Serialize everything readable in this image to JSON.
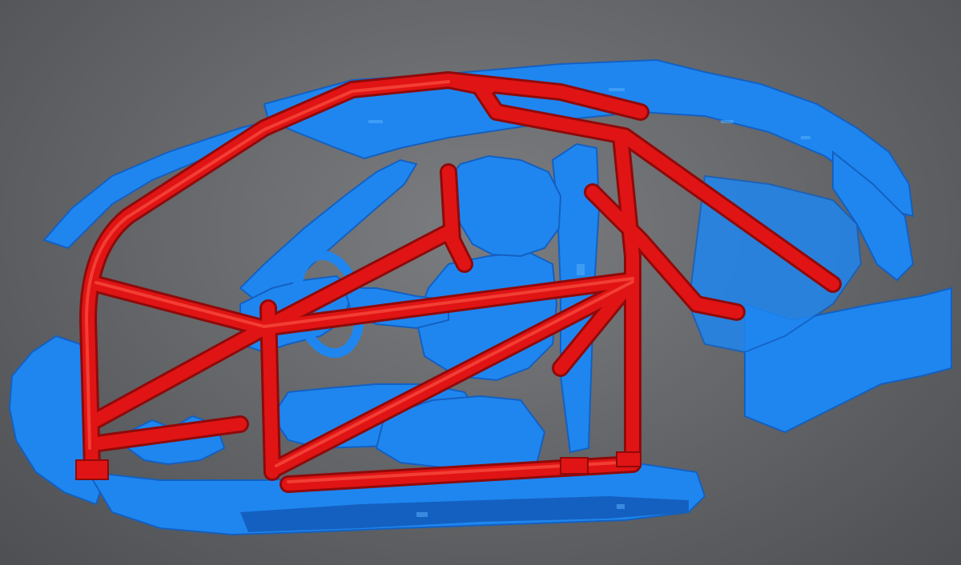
{
  "scene": {
    "subject": "vehicle-body-scan-with-roll-cage",
    "colors": {
      "background_center": "#7b7d80",
      "background_edge": "#4d4f52",
      "body_shell": "#1f86f0",
      "body_shell_shadow": "#1460c0",
      "body_shell_highlight": "#58aef7",
      "roll_cage": "#e01414",
      "roll_cage_shadow": "#8f0a0a",
      "roll_cage_highlight": "#ff5a4a"
    }
  }
}
